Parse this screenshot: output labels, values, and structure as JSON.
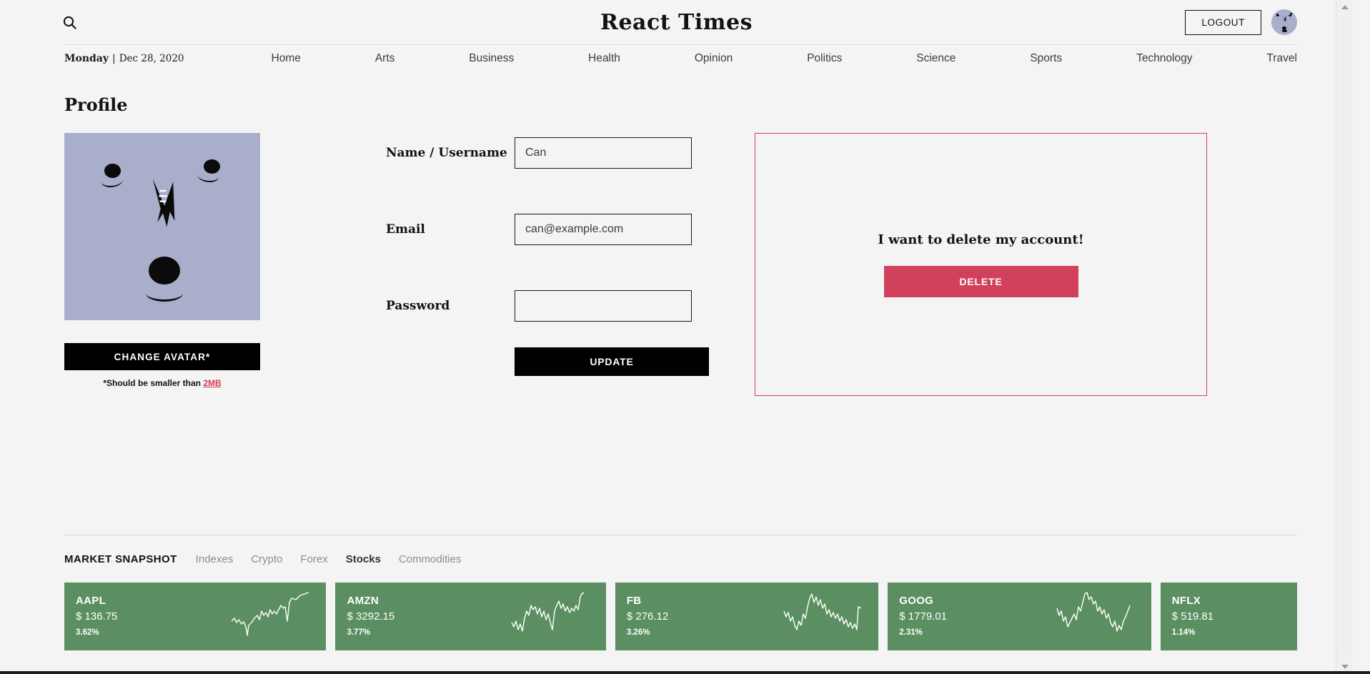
{
  "header": {
    "search_icon": "search-icon",
    "brand": "React Times",
    "logout_label": "LOGOUT",
    "avatar_icon": "user-avatar"
  },
  "nav": {
    "date_day": "Monday",
    "date_separator": "|",
    "date_rest": "Dec 28, 2020",
    "links": [
      {
        "label": "Home"
      },
      {
        "label": "Arts"
      },
      {
        "label": "Business"
      },
      {
        "label": "Health"
      },
      {
        "label": "Opinion"
      },
      {
        "label": "Politics"
      },
      {
        "label": "Science"
      },
      {
        "label": "Sports"
      },
      {
        "label": "Technology"
      },
      {
        "label": "Travel"
      }
    ]
  },
  "profile": {
    "title": "Profile",
    "change_avatar_label": "CHANGE AVATAR*",
    "avatar_note_prefix": "*Should be smaller than ",
    "avatar_note_link": "2MB",
    "fields": [
      {
        "label": "Name / Username",
        "value": "Can",
        "placeholder": "Name / Username",
        "type": "text"
      },
      {
        "label": "Email",
        "value": "can@example.com",
        "placeholder": "Email",
        "type": "text"
      },
      {
        "label": "Password",
        "value": "",
        "placeholder": "",
        "type": "password"
      }
    ],
    "update_label": "UPDATE"
  },
  "delete_panel": {
    "heading": "I want to delete my account!",
    "button_label": "DELETE",
    "border_color": "#d0415c",
    "button_color": "#d2415c"
  },
  "market": {
    "title": "MARKET SNAPSHOT",
    "tabs": [
      {
        "label": "Indexes",
        "active": false
      },
      {
        "label": "Crypto",
        "active": false
      },
      {
        "label": "Forex",
        "active": false
      },
      {
        "label": "Stocks",
        "active": true
      },
      {
        "label": "Commodities",
        "active": false
      }
    ],
    "card_color": "#5b8f61",
    "cards": [
      {
        "symbol": "AAPL",
        "price": "$ 136.75",
        "change": "3.62%"
      },
      {
        "symbol": "AMZN",
        "price": "$ 3292.15",
        "change": "3.77%"
      },
      {
        "symbol": "FB",
        "price": "$ 276.12",
        "change": "3.26%"
      },
      {
        "symbol": "GOOG",
        "price": "$ 1779.01",
        "change": "2.31%"
      },
      {
        "symbol": "NFLX",
        "price": "$ 519.81",
        "change": "1.14%"
      }
    ]
  },
  "chart_data": [
    {
      "type": "line",
      "title": "AAPL",
      "series": [
        {
          "name": "AAPL",
          "values": [
            42,
            46,
            43,
            48,
            45,
            50,
            47,
            44,
            52,
            58,
            50,
            54,
            62,
            66,
            60,
            64,
            70,
            66,
            72,
            78,
            74,
            80,
            72,
            78,
            86,
            84,
            90,
            96,
            88,
            94
          ]
        }
      ],
      "ylabel": "",
      "xlabel": "",
      "grid": false,
      "legend": "none"
    },
    {
      "type": "line",
      "title": "AMZN",
      "series": [
        {
          "name": "AMZN",
          "values": [
            30,
            26,
            34,
            28,
            40,
            50,
            62,
            58,
            70,
            66,
            74,
            60,
            68,
            56,
            48,
            40,
            36,
            46,
            58,
            72,
            80,
            76,
            86,
            70,
            64,
            74,
            68,
            62,
            78,
            96
          ]
        }
      ],
      "ylabel": "",
      "xlabel": "",
      "grid": false,
      "legend": "none"
    },
    {
      "type": "line",
      "title": "FB",
      "series": [
        {
          "name": "FB",
          "values": [
            58,
            48,
            62,
            42,
            54,
            46,
            58,
            50,
            66,
            84,
            96,
            88,
            76,
            90,
            82,
            66,
            54,
            60,
            48,
            56,
            44,
            50,
            38,
            44,
            34,
            40,
            30,
            36,
            28,
            56
          ]
        }
      ],
      "ylabel": "",
      "xlabel": "",
      "grid": false,
      "legend": "none"
    },
    {
      "type": "line",
      "title": "GOOG",
      "series": [
        {
          "name": "GOOG",
          "values": [
            62,
            50,
            40,
            44,
            34,
            42,
            56,
            48,
            66,
            58,
            96,
            88,
            92,
            84,
            74,
            80,
            66,
            58,
            50,
            44,
            56,
            48,
            34,
            26,
            38,
            30,
            44,
            36,
            52,
            62
          ]
        }
      ],
      "ylabel": "",
      "xlabel": "",
      "grid": false,
      "legend": "none"
    },
    {
      "type": "line",
      "title": "NFLX",
      "series": [
        {
          "name": "NFLX",
          "values": []
        }
      ],
      "ylabel": "",
      "xlabel": "",
      "grid": false,
      "legend": "none"
    }
  ]
}
